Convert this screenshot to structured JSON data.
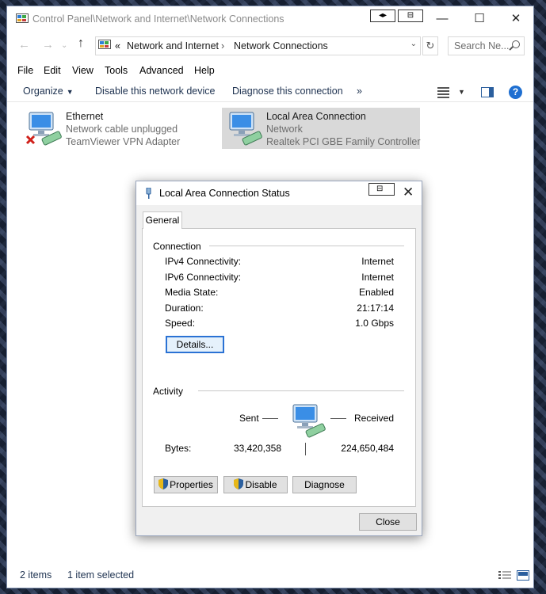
{
  "window": {
    "title": "Control Panel\\Network and Internet\\Network Connections",
    "minimize_glyph": "—",
    "maximize_glyph": "☐",
    "close_glyph": "✕",
    "snap_glyph_1": "◂▸",
    "snap_glyph_2": "⊟"
  },
  "address": {
    "back_glyph": "←",
    "forward_glyph": "→",
    "up_glyph": "↑",
    "overflow": "«",
    "crumbs": [
      "Network and Internet",
      "Network Connections"
    ],
    "separator": "›",
    "dropdown_glyph": "⌄",
    "refresh_glyph": "↻",
    "search_placeholder": "Search Ne..."
  },
  "menu": [
    "File",
    "Edit",
    "View",
    "Tools",
    "Advanced",
    "Help"
  ],
  "commands": {
    "organize": "Organize",
    "disable": "Disable this network device",
    "diagnose": "Diagnose this connection",
    "more": "»",
    "help": "?",
    "dropdown_glyph": "▼"
  },
  "connections": [
    {
      "name": "Ethernet",
      "status": "Network cable unplugged",
      "adapter": "TeamViewer VPN Adapter",
      "disconnected": true
    },
    {
      "name": "Local Area Connection",
      "status": "Network",
      "adapter": "Realtek PCI GBE Family Controller",
      "disconnected": false
    }
  ],
  "statusbar": {
    "count": "2 items",
    "selected": "1 item selected"
  },
  "dialog": {
    "title": "Local Area Connection Status",
    "close_glyph": "✕",
    "tab": "General",
    "connection_label": "Connection",
    "rows": [
      {
        "key": "IPv4 Connectivity:",
        "value": "Internet"
      },
      {
        "key": "IPv6 Connectivity:",
        "value": "Internet"
      },
      {
        "key": "Media State:",
        "value": "Enabled"
      },
      {
        "key": "Duration:",
        "value": "21:17:14"
      },
      {
        "key": "Speed:",
        "value": "1.0 Gbps"
      }
    ],
    "details_button": "Details...",
    "activity_label": "Activity",
    "sent_label": "Sent",
    "received_label": "Received",
    "bytes_label": "Bytes:",
    "bytes_sent": "33,420,358",
    "bytes_received": "224,650,484",
    "properties_button": "Properties",
    "disable_button": "Disable",
    "diagnose_button": "Diagnose",
    "close_button": "Close"
  },
  "colors": {
    "accent": "#1f6fd1",
    "link_text": "#1e3250",
    "selection": "#d9d9d9",
    "error_red": "#d0201a"
  }
}
